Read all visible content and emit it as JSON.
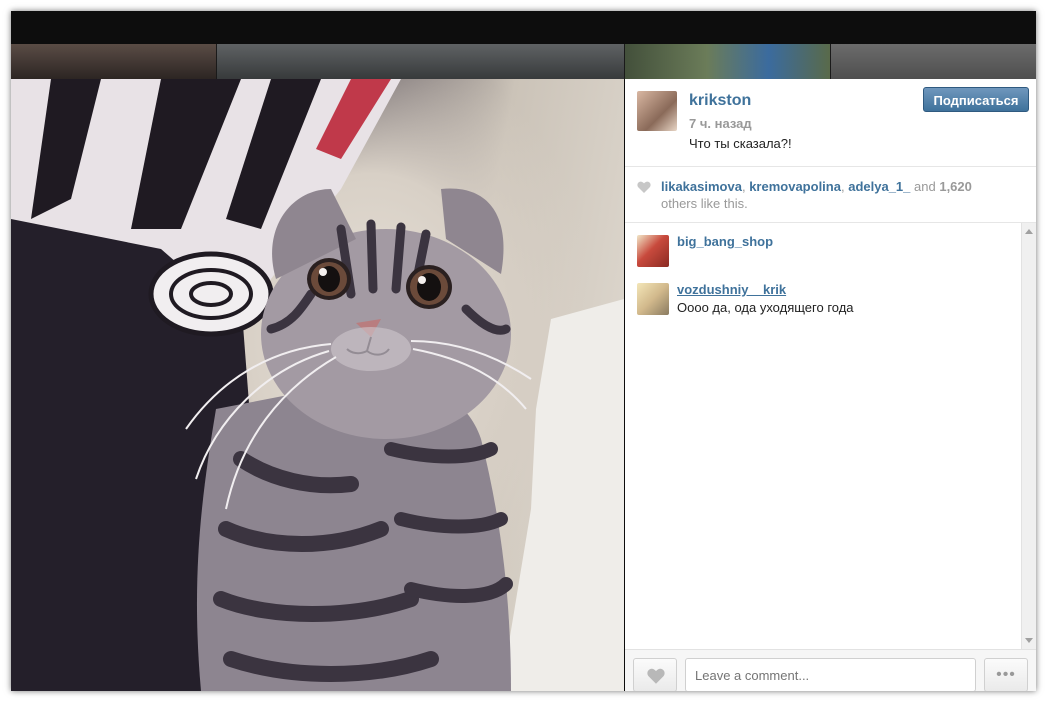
{
  "post": {
    "username": "krikston",
    "timestamp": "7 ч. назад",
    "caption": "Что ты сказала?!",
    "follow_label": "Подписаться"
  },
  "likes": {
    "users": [
      "likakasimova",
      "kremovapolina",
      "adelya_1_"
    ],
    "separator": ",",
    "and_label": "and",
    "count": "1,620",
    "suffix": "others like this."
  },
  "comments": [
    {
      "username": "big_bang_shop",
      "text": ""
    },
    {
      "username": "vozdushniy__krik",
      "text": "Оооо да, ода уходящего года"
    }
  ],
  "footer": {
    "comment_placeholder": "Leave a comment...",
    "more_label": "•••"
  },
  "colors": {
    "link_blue": "#3f729b",
    "muted_gray": "#999999",
    "overlay_dark": "#0d0d0d"
  },
  "icons": {
    "like": "heart-icon",
    "more": "ellipsis-icon"
  }
}
